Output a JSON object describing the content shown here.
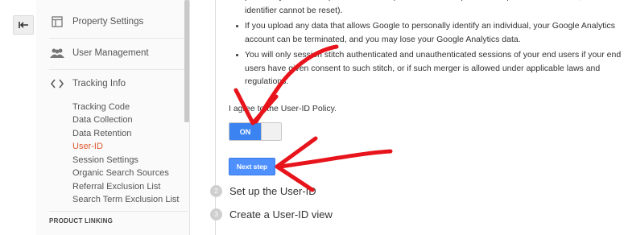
{
  "nav": {
    "back_icon": "back-arrow-icon"
  },
  "sidebar": {
    "property_settings": {
      "label": "Property Settings",
      "icon": "window-icon"
    },
    "user_management": {
      "label": "User Management",
      "icon": "people-icon"
    },
    "tracking_info": {
      "label": "Tracking Info",
      "icon": "code-icon",
      "items": [
        {
          "label": "Tracking Code"
        },
        {
          "label": "Data Collection"
        },
        {
          "label": "Data Retention"
        },
        {
          "label": "User-ID",
          "active": true
        },
        {
          "label": "Session Settings"
        },
        {
          "label": "Organic Search Sources"
        },
        {
          "label": "Referral Exclusion List"
        },
        {
          "label": "Search Term Exclusion List"
        }
      ]
    },
    "product_linking_heading": "PRODUCT LINKING"
  },
  "main": {
    "bullets": [
      "personally identifies a particular device (such as a mobile phone's unique device identifier, if such an identifier cannot be reset).",
      "If you upload any data that allows Google to personally identify an individual, your Google Analytics account can be terminated, and you may lose your Google Analytics data.",
      "You will only session stitch authenticated and unauthenticated sessions of your end users if your end users have given consent to such stitch, or if such merger is allowed under applicable laws and regulations."
    ],
    "agree_text": "I agree to the User-ID Policy.",
    "toggle": {
      "label": "ON",
      "state": "on",
      "color": "#3b83f1"
    },
    "next_button": "Next step",
    "steps": [
      {
        "number": "2",
        "label": "Set up the User-ID"
      },
      {
        "number": "3",
        "label": "Create a User-ID view"
      }
    ]
  },
  "annotations": {
    "arrow_color": "#e8141c"
  }
}
